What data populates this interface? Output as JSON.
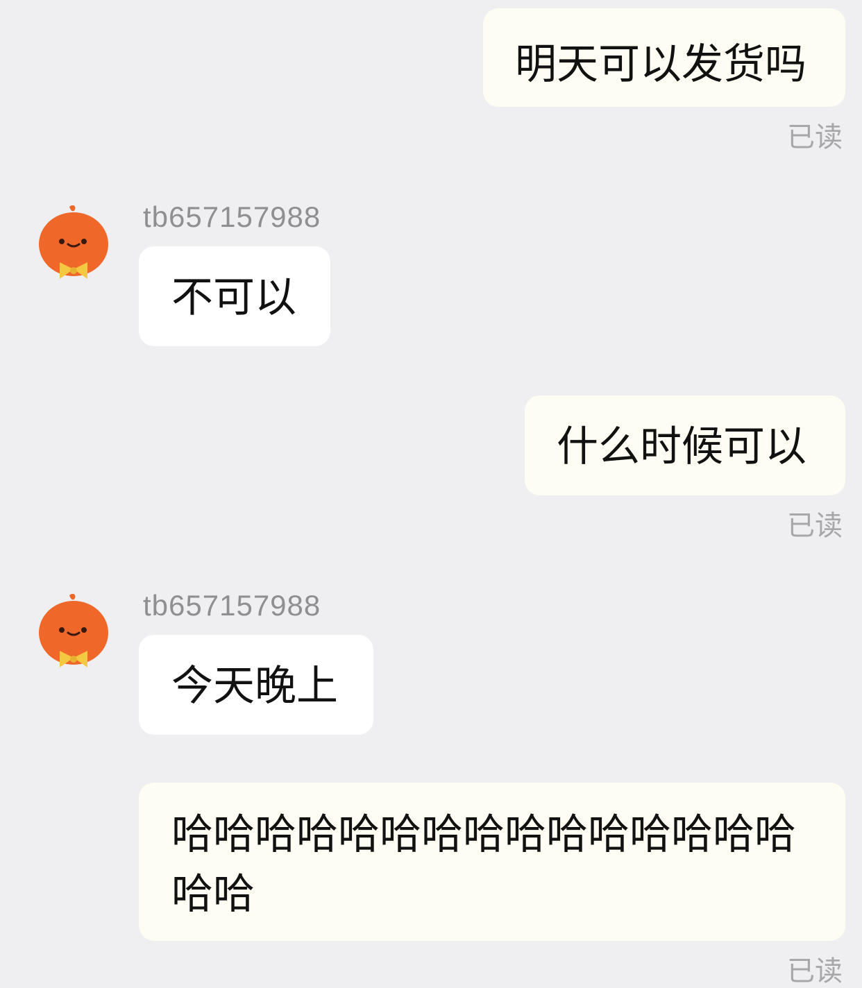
{
  "messages": [
    {
      "side": "out",
      "text": "明天可以发货吗",
      "status": "已读"
    },
    {
      "side": "in",
      "sender": "tb657157988",
      "text": "不可以",
      "avatar_icon": "orange-mascot-icon"
    },
    {
      "side": "out",
      "text": "什么时候可以",
      "status": "已读"
    },
    {
      "side": "in",
      "sender": "tb657157988",
      "text": "今天晚上",
      "avatar_icon": "orange-mascot-icon"
    },
    {
      "side": "out",
      "text": "哈哈哈哈哈哈哈哈哈哈哈哈哈哈哈哈哈",
      "status": "已读"
    }
  ],
  "colors": {
    "background": "#efeff1",
    "outgoing_bubble": "#fdfdf3",
    "incoming_bubble": "#ffffff",
    "read_status": "#a7a7ab",
    "avatar_orange": "#f0672a",
    "avatar_bow": "#f5c842"
  }
}
